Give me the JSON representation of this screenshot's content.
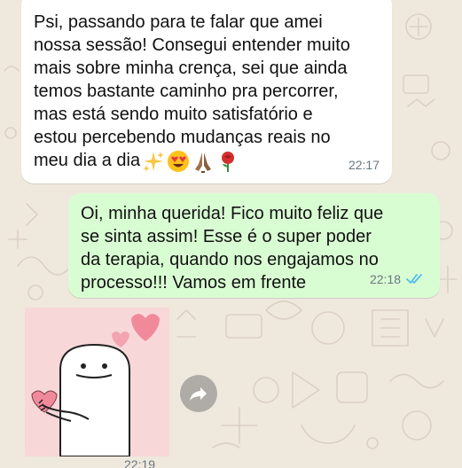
{
  "incoming_message": {
    "lines": [
      "Psi, passando para te falar que amei",
      "nossa sessão! Consegui entender muito",
      "mais sobre minha crença, sei que ainda",
      "temos bastante caminho pra percorrer,",
      "mas está sendo muito satisfatório e",
      "estou percebendo mudanças reais no",
      "meu dia a dia"
    ],
    "emojis": [
      "sparkles-icon",
      "heart-eyes-icon",
      "praying-hands-icon",
      "rose-icon"
    ],
    "time": "22:17"
  },
  "outgoing_message": {
    "lines": [
      "Oi, minha querida! Fico muito feliz que",
      "se sinta assim! Esse é o super poder",
      "da terapia, quando nos engajamos no",
      "processo!!! Vamos em frente"
    ],
    "time": "22:18",
    "status_icon": "double-check-icon",
    "status_color": "#53bdeb"
  },
  "sticker_message": {
    "sticker_icon": "flork-holding-heart-sticker",
    "forward_icon": "forward-icon",
    "time": "22:19"
  },
  "colors": {
    "chat_background": "#efe8dd",
    "incoming_bubble": "#ffffff",
    "outgoing_bubble": "#d9fdd3",
    "sticker_bg": "#f8d7d8",
    "heart": "#f08a9a"
  }
}
